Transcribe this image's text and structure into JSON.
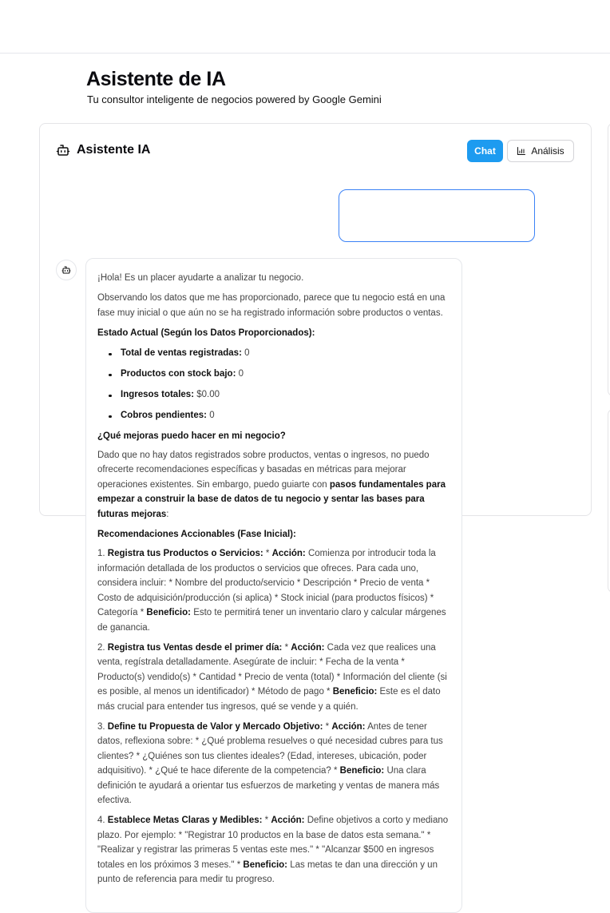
{
  "header": {
    "title": "Asistente de IA",
    "subtitle": "Tu consultor inteligente de negocios powered by Google Gemini"
  },
  "panel": {
    "title": "Asistente IA",
    "tabs": {
      "chat": "Chat",
      "analysis": "Análisis"
    },
    "active_tab": "Chat",
    "accent_color": "#1d9bf0"
  },
  "user_message": {
    "text": ""
  },
  "assistant_message": {
    "greeting": "¡Hola! Es un placer ayudarte a analizar tu negocio.",
    "intro": "Observando los datos que me has proporcionado, parece que tu negocio está en una fase muy inicial o que aún no se ha registrado información sobre productos o ventas.",
    "status_heading": "Estado Actual (Según los Datos Proporcionados):",
    "stats": [
      {
        "label": "Total de ventas registradas:",
        "value": "0"
      },
      {
        "label": "Productos con stock bajo:",
        "value": "0"
      },
      {
        "label": "Ingresos totales:",
        "value": "$0.00"
      },
      {
        "label": "Cobros pendientes:",
        "value": "0"
      }
    ],
    "question_heading": "¿Qué mejoras puedo hacer en mi negocio?",
    "question_text": "Dado que no hay datos registrados sobre productos, ventas o ingresos, no puedo ofrecerte recomendaciones específicas y basadas en métricas para mejorar operaciones existentes. Sin embargo, puedo guiarte con",
    "question_bold": "pasos fundamentales para empezar a construir la base de datos de tu negocio y sentar las bases para futuras mejoras",
    "question_end": ":",
    "recommendations_heading": "Recomendaciones Accionables (Fase Inicial):",
    "recommendations": [
      {
        "num": "1.",
        "title": "Registra tus Productos o Servicios:",
        "action_label": "Acción:",
        "action_text": "Comienza por introducir toda la información detallada de los productos o servicios que ofreces. Para cada uno, considera incluir: * Nombre del producto/servicio * Descripción * Precio de venta * Costo de adquisición/producción (si aplica) * Stock inicial (para productos físicos) * Categoría *",
        "benefit_label": "Beneficio:",
        "benefit_text": "Esto te permitirá tener un inventario claro y calcular márgenes de ganancia."
      },
      {
        "num": "2.",
        "title": "Registra tus Ventas desde el primer día:",
        "action_label": "Acción:",
        "action_text": "Cada vez que realices una venta, regístrala detalladamente. Asegúrate de incluir: * Fecha de la venta * Producto(s) vendido(s) * Cantidad * Precio de venta (total) * Información del cliente (si es posible, al menos un identificador) * Método de pago *",
        "benefit_label": "Beneficio:",
        "benefit_text": "Este es el dato más crucial para entender tus ingresos, qué se vende y a quién."
      },
      {
        "num": "3.",
        "title": "Define tu Propuesta de Valor y Mercado Objetivo:",
        "action_label": "Acción:",
        "action_text": "Antes de tener datos, reflexiona sobre: * ¿Qué problema resuelves o qué necesidad cubres para tus clientes? * ¿Quiénes son tus clientes ideales? (Edad, intereses, ubicación, poder adquisitivo). * ¿Qué te hace diferente de la competencia? *",
        "benefit_label": "Beneficio:",
        "benefit_text": "Una clara definición te ayudará a orientar tus esfuerzos de marketing y ventas de manera más efectiva."
      },
      {
        "num": "4.",
        "title": "Establece Metas Claras y Medibles:",
        "action_label": "Acción:",
        "action_text": "Define objetivos a corto y mediano plazo. Por ejemplo: * \"Registrar 10 productos en la base de datos esta semana.\" * \"Realizar y registrar las primeras 5 ventas este mes.\" * \"Alcanzar $500 en ingresos totales en los próximos 3 meses.\" *",
        "benefit_label": "Beneficio:",
        "benefit_text": "Las metas te dan una dirección y un punto de referencia para medir tu progreso."
      }
    ]
  }
}
